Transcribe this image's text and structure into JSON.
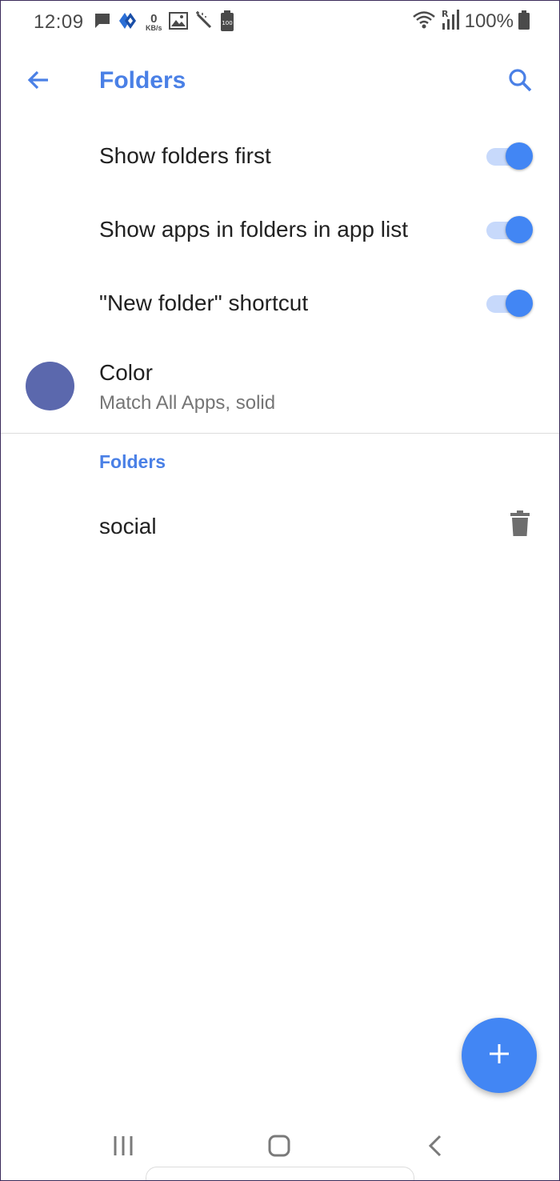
{
  "status_bar": {
    "time": "12:09",
    "net_speed_value": "0",
    "net_speed_unit": "KB/s",
    "battery_text": "100%",
    "icons": [
      "message-icon",
      "app-notification-icon",
      "net-speed-icon",
      "image-icon",
      "magic-wand-icon",
      "battery-saver-icon",
      "wifi-icon",
      "roaming-signal-icon",
      "battery-icon"
    ]
  },
  "app_bar": {
    "title": "Folders",
    "back_icon": "back-arrow-icon",
    "search_icon": "search-icon"
  },
  "settings": [
    {
      "label": "Show folders first",
      "enabled": true
    },
    {
      "label": "Show apps in folders in app list",
      "enabled": true
    },
    {
      "label": "\"New folder\" shortcut",
      "enabled": true
    }
  ],
  "color_setting": {
    "title": "Color",
    "subtitle": "Match All Apps, solid",
    "swatch_color": "#5b68ad"
  },
  "folders_section": {
    "header": "Folders",
    "items": [
      {
        "name": "social",
        "action_icon": "delete-icon"
      }
    ]
  },
  "fab": {
    "icon": "plus-icon"
  },
  "nav_bar": {
    "icons": [
      "recent-apps-icon",
      "home-icon",
      "back-icon"
    ]
  },
  "colors": {
    "accent": "#4a80e6",
    "switch_thumb": "#4286f4",
    "switch_track": "#c7d9fb",
    "text_primary": "#212121",
    "text_secondary": "#757575"
  }
}
